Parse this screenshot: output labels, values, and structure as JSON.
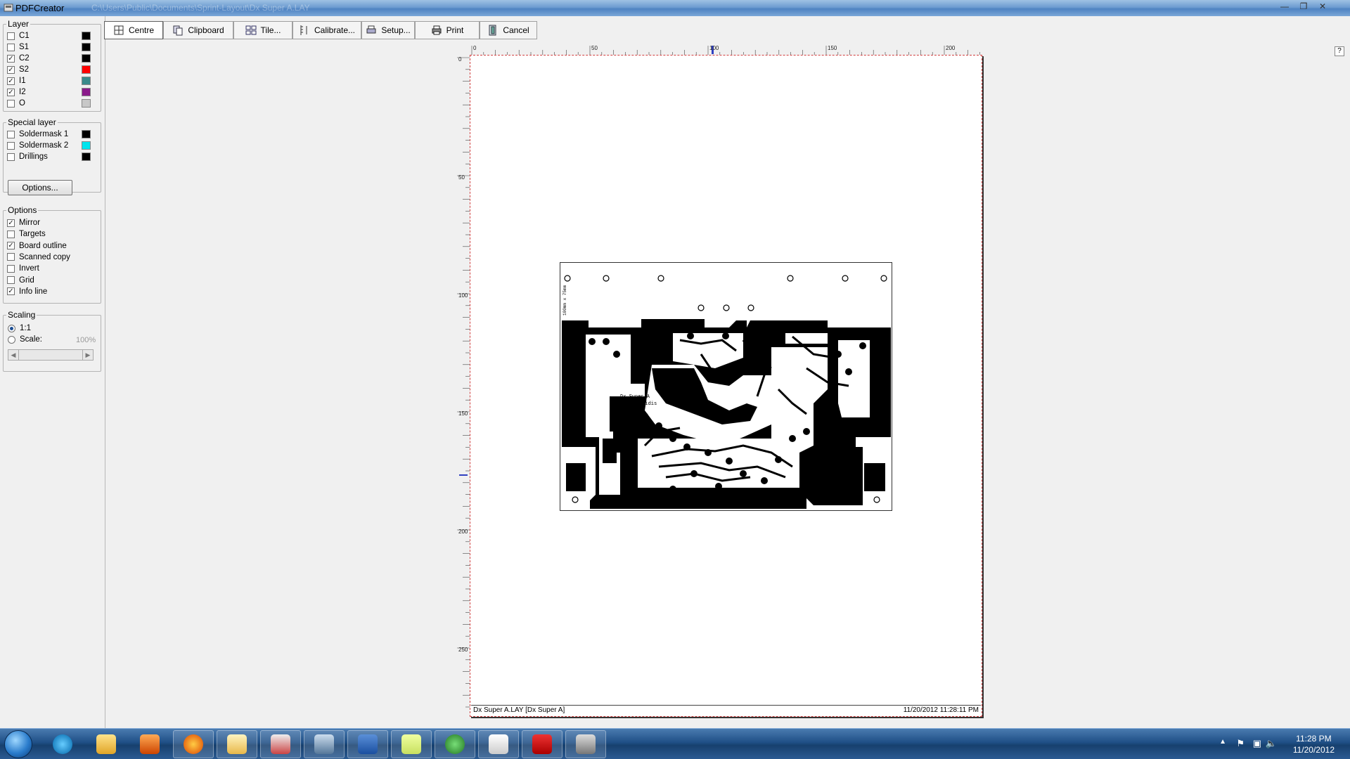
{
  "window": {
    "title": "PDFCreator",
    "path": "C:\\Users\\Public\\Documents\\Sprint-Layout\\Dx Super A.LAY",
    "minimize": "—",
    "restore": "❐",
    "close": "✕"
  },
  "toolbar": {
    "centre": "Centre",
    "clipboard": "Clipboard",
    "tile": "Tile...",
    "calibrate": "Calibrate...",
    "setup": "Setup...",
    "print": "Print",
    "cancel": "Cancel"
  },
  "layers": {
    "title": "Layer",
    "items": [
      {
        "label": "C1",
        "checked": false,
        "color": "#000000"
      },
      {
        "label": "S1",
        "checked": false,
        "color": "#000000"
      },
      {
        "label": "C2",
        "checked": true,
        "color": "#000000"
      },
      {
        "label": "S2",
        "checked": true,
        "color": "#ff0000"
      },
      {
        "label": "I1",
        "checked": true,
        "color": "#3a8a8a"
      },
      {
        "label": "I2",
        "checked": true,
        "color": "#8a1a8a"
      },
      {
        "label": "O",
        "checked": false,
        "color": "#c8c8c8"
      }
    ]
  },
  "special_layers": {
    "title": "Special layer",
    "items": [
      {
        "label": "Soldermask 1",
        "checked": false,
        "color": "#000000"
      },
      {
        "label": "Soldermask 2",
        "checked": false,
        "color": "#00e5ee"
      },
      {
        "label": "Drillings",
        "checked": false,
        "color": "#000000"
      }
    ],
    "options_button": "Options..."
  },
  "options": {
    "title": "Options",
    "items": [
      {
        "label": "Mirror",
        "checked": true
      },
      {
        "label": "Targets",
        "checked": false
      },
      {
        "label": "Board outline",
        "checked": true
      },
      {
        "label": "Scanned copy",
        "checked": false
      },
      {
        "label": "Invert",
        "checked": false
      },
      {
        "label": "Grid",
        "checked": false
      },
      {
        "label": "Info line",
        "checked": true
      }
    ]
  },
  "scaling": {
    "title": "Scaling",
    "one_to_one": "1:1",
    "scale": "Scale:",
    "scale_value": "100%"
  },
  "ruler": {
    "h_labels": [
      "0",
      "50",
      "100",
      "150",
      "200"
    ],
    "v_labels": [
      "0",
      "50",
      "100",
      "150",
      "200",
      "250"
    ]
  },
  "page": {
    "info_left": "Dx Super A.LAY  [Dx Super A]",
    "info_right": "11/20/2012  11:28:11 PM",
    "board_text_1": "Dx Super A",
    "board_text_2": "Costas Hnlogidis",
    "board_side_text": "100mm  x  75mm"
  },
  "help": "?",
  "taskbar": {
    "time": "11:28 PM",
    "date": "11/20/2012",
    "tray_arrow": "▲"
  }
}
